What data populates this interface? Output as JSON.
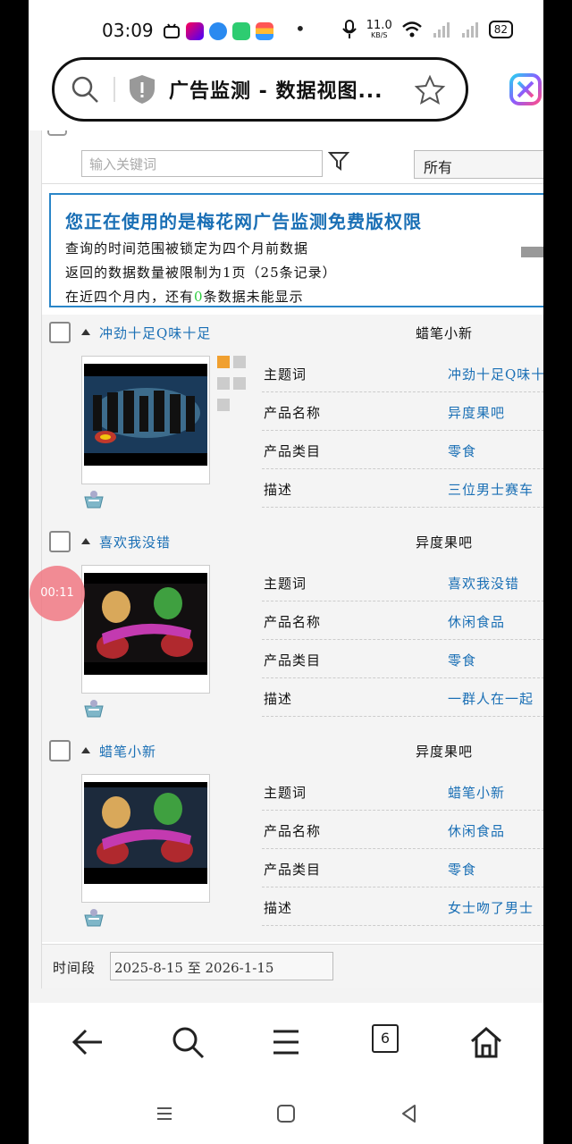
{
  "status_bar": {
    "time": "03:09",
    "dot": "•",
    "speed_value": "11.0",
    "speed_unit": "KB/S",
    "battery": "82"
  },
  "url_bar": {
    "title": "广告监测 - 数据视图..."
  },
  "filter": {
    "keyword_placeholder": "输入关键词",
    "category_value": "所有"
  },
  "notice": {
    "title": "您正在使用的是梅花网广告监测免费版权限",
    "line1": "查询的时间范围被锁定为四个月前数据",
    "line2": "返回的数据数量被限制为1页（25条记录）",
    "line3_prefix": "在近四个月内，还有",
    "line3_count": "0",
    "line3_suffix": "条数据未能显示"
  },
  "field_labels": {
    "theme": "主题词",
    "product": "产品名称",
    "category": "产品类目",
    "desc": "描述"
  },
  "records": [
    {
      "title": "冲劲十足Q味十足",
      "brand": "蜡笔小新",
      "theme": "冲劲十足Q味十足",
      "product": "异度果吧",
      "category": "零食",
      "desc": "三位男士赛车"
    },
    {
      "title": "喜欢我没错",
      "brand": "异度果吧",
      "theme": "喜欢我没错",
      "product": "休闲食品",
      "category": "零食",
      "desc": "一群人在一起"
    },
    {
      "title": "蜡笔小新",
      "brand": "异度果吧",
      "theme": "蜡笔小新",
      "product": "休闲食品",
      "category": "零食",
      "desc": "女士吻了男士"
    }
  ],
  "time_range": {
    "label": "时间段",
    "value": "2025-8-15 至 2026-1-15"
  },
  "timer": "00:11",
  "toolbar": {
    "tab_count": "6"
  },
  "colors": {
    "accent_blue": "#1a6fb5",
    "notice_border": "#2a86c8",
    "highlight_green": "#2ecc40",
    "timer_bubble": "#f07882"
  }
}
